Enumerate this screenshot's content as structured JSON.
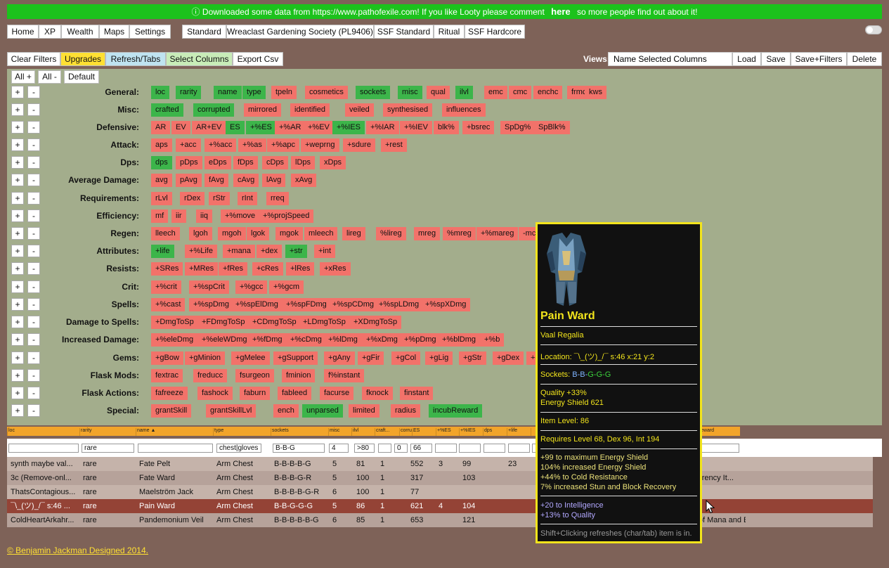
{
  "banner": {
    "info_icon": "info-circle-icon",
    "text_before": "Downloaded some data from https://www.pathofexile.com! If you like Looty please comment",
    "link": "here",
    "text_after": "so more people find out about it!"
  },
  "nav": [
    "Home",
    "XP",
    "Wealth",
    "Maps",
    "Settings"
  ],
  "leagues": [
    "Standard",
    "Wreaclast Gardening Society (PL9406)",
    "SSF Standard",
    "Ritual",
    "SSF Hardcore"
  ],
  "toolbar": {
    "clear_filters": "Clear Filters",
    "upgrades": "Upgrades",
    "refresh_tabs": "Refresh/Tabs",
    "select_columns": "Select Columns",
    "export_csv": "Export Csv"
  },
  "views": {
    "label": "Views:",
    "input_value": "Name Selected Columns",
    "load": "Load",
    "save": "Save",
    "save_filters": "Save+Filters",
    "delete": "Delete"
  },
  "column_controls": {
    "all_plus": "All +",
    "all_minus": "All -",
    "default": "Default",
    "plus": "+",
    "minus": "-"
  },
  "groups": [
    {
      "label": "General:",
      "chips": [
        [
          "loc",
          1
        ],
        [
          "rarity",
          1
        ],
        [
          "name",
          1
        ],
        [
          "type",
          1
        ],
        [
          "tpeln",
          0
        ],
        [
          "cosmetics",
          0
        ],
        [
          "sockets",
          1
        ],
        [
          "misc",
          1
        ],
        [
          "qual",
          0
        ],
        [
          "ilvl",
          1
        ],
        [
          "emc",
          0
        ],
        [
          "cmc",
          0
        ],
        [
          "enchc",
          0
        ],
        [
          "frmc",
          0
        ],
        [
          "kws",
          0
        ]
      ]
    },
    {
      "label": "Misc:",
      "chips": [
        [
          "crafted",
          1
        ],
        [
          "corrupted",
          1
        ],
        [
          "mirrored",
          0
        ],
        [
          "identified",
          0
        ],
        [
          "veiled",
          0
        ],
        [
          "synthesised",
          0
        ],
        [
          "influences",
          0
        ]
      ]
    },
    {
      "label": "Defensive:",
      "chips": [
        [
          "AR",
          0
        ],
        [
          "EV",
          0
        ],
        [
          "AR+EV",
          0
        ],
        [
          "ES",
          1
        ],
        [
          "+%ES",
          1
        ],
        [
          "+%AR",
          0
        ],
        [
          "+%EV",
          0
        ],
        [
          "+%IES",
          1
        ],
        [
          "+%IAR",
          0
        ],
        [
          "+%IEV",
          0
        ],
        [
          "blk%",
          0
        ],
        [
          "+bsrec",
          0
        ],
        [
          "SpDg%",
          0
        ],
        [
          "SpBlk%",
          0
        ]
      ]
    },
    {
      "label": "Attack:",
      "chips": [
        [
          "aps",
          0
        ],
        [
          "+acc",
          0
        ],
        [
          "+%acc",
          0
        ],
        [
          "+%as",
          0
        ],
        [
          "+%apc",
          0
        ],
        [
          "+weprng",
          0
        ],
        [
          "+sdure",
          0
        ],
        [
          "+rest",
          0
        ]
      ]
    },
    {
      "label": "Dps:",
      "chips": [
        [
          "dps",
          1
        ],
        [
          "pDps",
          0
        ],
        [
          "eDps",
          0
        ],
        [
          "fDps",
          0
        ],
        [
          "cDps",
          0
        ],
        [
          "lDps",
          0
        ],
        [
          "xDps",
          0
        ]
      ]
    },
    {
      "label": "Average Damage:",
      "chips": [
        [
          "avg",
          0
        ],
        [
          "pAvg",
          0
        ],
        [
          "fAvg",
          0
        ],
        [
          "cAvg",
          0
        ],
        [
          "lAvg",
          0
        ],
        [
          "xAvg",
          0
        ]
      ]
    },
    {
      "label": "Requirements:",
      "chips": [
        [
          "rLvl",
          0
        ],
        [
          "rDex",
          0
        ],
        [
          "rStr",
          0
        ],
        [
          "rInt",
          0
        ],
        [
          "rreq",
          0
        ]
      ]
    },
    {
      "label": "Efficiency:",
      "chips": [
        [
          "mf",
          0
        ],
        [
          "iir",
          0
        ],
        [
          "iiq",
          0
        ],
        [
          "+%move",
          0
        ],
        [
          "+%projSpeed",
          0
        ]
      ]
    },
    {
      "label": "Regen:",
      "chips": [
        [
          "lleech",
          0
        ],
        [
          "lgoh",
          0
        ],
        [
          "mgoh",
          0
        ],
        [
          "lgok",
          0
        ],
        [
          "mgok",
          0
        ],
        [
          "mleech",
          0
        ],
        [
          "lireg",
          0
        ],
        [
          "%lireg",
          0
        ],
        [
          "mreg",
          0
        ],
        [
          "%mreg",
          0
        ],
        [
          "+%mareg",
          0
        ],
        [
          "-mco",
          0
        ]
      ]
    },
    {
      "label": "Attributes:",
      "chips": [
        [
          "+life",
          1
        ],
        [
          "+%Life",
          0
        ],
        [
          "+mana",
          0
        ],
        [
          "+dex",
          0
        ],
        [
          "+str",
          1
        ],
        [
          "+int",
          0
        ]
      ]
    },
    {
      "label": "Resists:",
      "chips": [
        [
          "+SRes",
          0
        ],
        [
          "+MRes",
          0
        ],
        [
          "+fRes",
          0
        ],
        [
          "+cRes",
          0
        ],
        [
          "+lRes",
          0
        ],
        [
          "+xRes",
          0
        ]
      ]
    },
    {
      "label": "Crit:",
      "chips": [
        [
          "+%crit",
          0
        ],
        [
          "+%spCrit",
          0
        ],
        [
          "+%gcc",
          0
        ],
        [
          "+%gcm",
          0
        ]
      ]
    },
    {
      "label": "Spells:",
      "chips": [
        [
          "+%cast",
          0
        ],
        [
          "+%spDmg",
          0
        ],
        [
          "+%spElDmg",
          0
        ],
        [
          "+%spFDmg",
          0
        ],
        [
          "+%spCDmg",
          0
        ],
        [
          "+%spLDmg",
          0
        ],
        [
          "+%spXDmg",
          0
        ]
      ]
    },
    {
      "label": "Damage to Spells:",
      "chips": [
        [
          "+DmgToSp",
          0
        ],
        [
          "+FDmgToSp",
          0
        ],
        [
          "+CDmgToSp",
          0
        ],
        [
          "+LDmgToSp",
          0
        ],
        [
          "+XDmgToSp",
          0
        ]
      ]
    },
    {
      "label": "Increased Damage:",
      "chips": [
        [
          "+%eleDmg",
          0
        ],
        [
          "+%eleWDmg",
          0
        ],
        [
          "+%fDmg",
          0
        ],
        [
          "+%cDmg",
          0
        ],
        [
          "+%lDmg",
          0
        ],
        [
          "+%xDmg",
          0
        ],
        [
          "+%pDmg",
          0
        ],
        [
          "+%blDmg",
          0
        ],
        [
          "+%b",
          0
        ]
      ]
    },
    {
      "label": "Gems:",
      "chips": [
        [
          "+gBow",
          0
        ],
        [
          "+gMinion",
          0
        ],
        [
          "+gMelee",
          0
        ],
        [
          "+gSupport",
          0
        ],
        [
          "+gAny",
          0
        ],
        [
          "+gFir",
          0
        ],
        [
          "+gCol",
          0
        ],
        [
          "+gLig",
          0
        ],
        [
          "+gStr",
          0
        ],
        [
          "+gDex",
          0
        ],
        [
          "+g",
          0
        ]
      ]
    },
    {
      "label": "Flask Mods:",
      "chips": [
        [
          "fextrac",
          0
        ],
        [
          "freducc",
          0
        ],
        [
          "fsurgeon",
          0
        ],
        [
          "fminion",
          0
        ],
        [
          "f%instant",
          0
        ]
      ]
    },
    {
      "label": "Flask Actions:",
      "chips": [
        [
          "fafreeze",
          0
        ],
        [
          "fashock",
          0
        ],
        [
          "faburn",
          0
        ],
        [
          "fableed",
          0
        ],
        [
          "facurse",
          0
        ],
        [
          "fknock",
          0
        ],
        [
          "finstant",
          0
        ]
      ]
    },
    {
      "label": "Special:",
      "chips": [
        [
          "grantSkill",
          0
        ],
        [
          "grantSkillLvl",
          0
        ],
        [
          "ench",
          0
        ],
        [
          "unparsed",
          1
        ],
        [
          "limited",
          0
        ],
        [
          "radius",
          0
        ],
        [
          "incubReward",
          1
        ]
      ]
    }
  ],
  "table": {
    "headers": [
      "loc",
      "rarity",
      "name ▲",
      "type",
      "sockets",
      "misc",
      "ilvl",
      "craft...",
      "corru...",
      "ES",
      "+%ES",
      "+%IES",
      "dps",
      "+life",
      "",
      "",
      "",
      "",
      "",
      "",
      "",
      "eward"
    ],
    "filters": [
      "",
      "rare",
      "",
      "chest|gloves",
      "B-B-G",
      "4",
      ">80",
      "",
      "0",
      "66",
      "",
      "",
      "",
      "",
      "",
      "",
      ""
    ],
    "rows": [
      [
        "synth maybe val...",
        "rare",
        "Fate Pelt",
        "Arm Chest",
        "B-B-B-B-G",
        "5",
        "81",
        "1",
        "",
        "552",
        "3",
        "99",
        "",
        "23"
      ],
      [
        "3c (Remove-onl...",
        "rare",
        "Fate Ward",
        "Arm Chest",
        "B-B-B-G-R",
        "5",
        "100",
        "1",
        "",
        "317",
        "",
        "103",
        "",
        "",
        "Currency It..."
      ],
      [
        "ThatsContagious...",
        "rare",
        "Maelström Jack",
        "Arm Chest",
        "B-B-B-B-G-R",
        "6",
        "100",
        "1",
        "",
        "77"
      ],
      [
        "¯\\_(ツ)_/¯ s:46 ...",
        "rare",
        "Pain Ward",
        "Arm Chest",
        "B-B-G-G-G",
        "5",
        "86",
        "1",
        "",
        "621",
        "4",
        "104"
      ],
      [
        "ColdHeartArkahr...",
        "rare",
        "Pandemonium Veil",
        "Arm Chest",
        "B-B-B-B-B-G",
        "6",
        "85",
        "1",
        "",
        "653",
        "",
        "121",
        "",
        "",
        "% of Mana and Ener..."
      ]
    ]
  },
  "tooltip": {
    "item_image": "armour-icon",
    "name": "Pain Ward",
    "base": "Vaal Regalia",
    "location": "Location: ¯\\_(ツ)_/¯ s:46 x:21 y:2",
    "sockets_label": "Sockets:",
    "sockets_blue": "B-B-",
    "sockets_green": "G-G-G",
    "quality": "Quality +33%",
    "energy_shield": "Energy Shield 621",
    "item_level": "Item Level: 86",
    "requires": "Requires Level 68, Dex 96, Int 194",
    "mods": [
      "+99 to maximum Energy Shield",
      "104% increased Energy Shield",
      "+44% to Cold Resistance",
      "7% increased Stun and Block Recovery"
    ],
    "implicits": [
      "+20 to Intelligence",
      "+13% to Quality"
    ],
    "hint": "Shift+Clicking refreshes (char/tab) item is in."
  },
  "footer": "©  Benjamin Jackman Designed 2014."
}
